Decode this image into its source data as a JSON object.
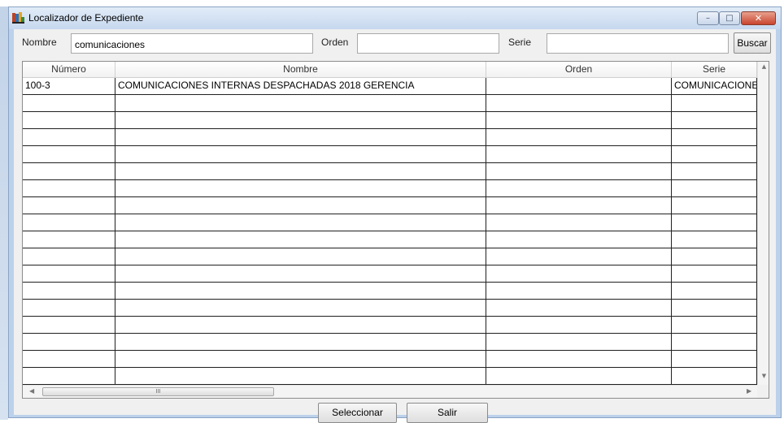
{
  "window": {
    "title": "Localizador de Expediente",
    "controls": {
      "minimize": "–",
      "maximize": "□",
      "close": "✕"
    }
  },
  "search": {
    "nombre_label": "Nombre",
    "nombre_value": "comunicaciones",
    "orden_label": "Orden",
    "orden_value": "",
    "serie_label": "Serie",
    "serie_value": "",
    "buscar_label": "Buscar"
  },
  "grid": {
    "columns": [
      "Número",
      "Nombre",
      "Orden",
      "Serie"
    ],
    "rows": [
      [
        "100-3",
        "COMUNICACIONES INTERNAS DESPACHADAS 2018 GERENCIA",
        "",
        "COMUNICACIONES INTERNAS"
      ],
      [
        "",
        "",
        "",
        ""
      ],
      [
        "",
        "",
        "",
        ""
      ],
      [
        "",
        "",
        "",
        ""
      ],
      [
        "",
        "",
        "",
        ""
      ],
      [
        "",
        "",
        "",
        ""
      ],
      [
        "",
        "",
        "",
        ""
      ],
      [
        "",
        "",
        "",
        ""
      ],
      [
        "",
        "",
        "",
        ""
      ],
      [
        "",
        "",
        "",
        ""
      ],
      [
        "",
        "",
        "",
        ""
      ],
      [
        "",
        "",
        "",
        ""
      ],
      [
        "",
        "",
        "",
        ""
      ],
      [
        "",
        "",
        "",
        ""
      ],
      [
        "",
        "",
        "",
        ""
      ],
      [
        "",
        "",
        "",
        ""
      ],
      [
        "",
        "",
        "",
        ""
      ],
      [
        "",
        "",
        "",
        ""
      ]
    ],
    "scroll_thumb_grip": "III"
  },
  "footer": {
    "seleccionar_label": "Seleccionar",
    "salir_label": "Salir"
  },
  "colors": {
    "title_bar": "#c6d8ee",
    "close_button": "#c8452d",
    "client_background": "#f0f0f0"
  },
  "icons": [
    "app-icon",
    "minimize-icon",
    "maximize-icon",
    "close-icon",
    "scroll-up-icon",
    "scroll-down-icon",
    "scroll-left-icon",
    "scroll-right-icon"
  ]
}
